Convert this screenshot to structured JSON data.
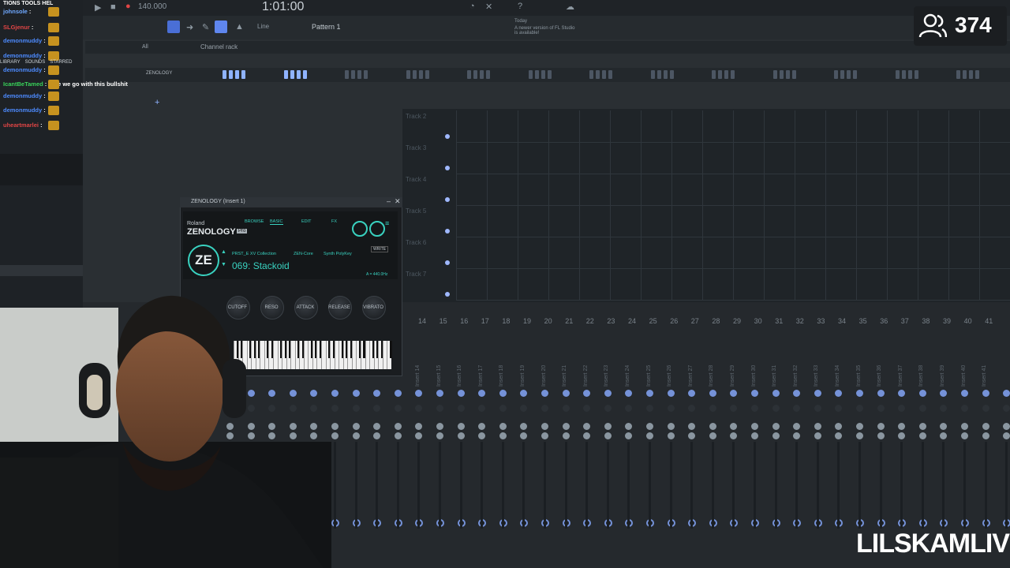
{
  "toolbar": {
    "tempo": "140.000",
    "time": "1:01:00",
    "pattern": "Pattern 1",
    "snap": "Line",
    "news_title": "Today",
    "news_text": "A newer version of FL Studio is available!"
  },
  "browser": {
    "channel_rack_label": "Channel rack",
    "filter_label": "All",
    "channel_name": "ZENOLOGY",
    "tabs": [
      "LIBRARY",
      "SOUNDS",
      "STARRED"
    ]
  },
  "chat": {
    "messages": [
      {
        "user": "johnsole",
        "text": ""
      },
      {
        "user": "SLGjenur",
        "text": ""
      },
      {
        "user": "demonmuddy",
        "text": ""
      },
      {
        "user": "demonmuddy",
        "text": ""
      },
      {
        "user": "demonmuddy",
        "text": ""
      },
      {
        "user": "IcantBeTamed",
        "text": "here we go with this bullshit"
      },
      {
        "user": "demonmuddy",
        "text": ""
      },
      {
        "user": "demonmuddy",
        "text": ""
      },
      {
        "user": "uheartmarlei",
        "text": ""
      }
    ],
    "header": "TIONS TOOLS HEL"
  },
  "playlist": {
    "tracks": [
      "Track 2",
      "Track 3",
      "Track 4",
      "Track 5",
      "Track 6",
      "Track 7"
    ]
  },
  "plugin": {
    "window_title": "ZENOLOGY (Insert 1)",
    "brand": "Roland",
    "product": "ZENOLOGY",
    "edition": "Pro",
    "logo": "ZE",
    "tabs": [
      "BROWSE",
      "BASIC",
      "EDIT",
      "FX"
    ],
    "active_tab": "BASIC",
    "collection": "PRST_E XV Collection",
    "core": "ZEN-Core",
    "category": "Synth PolyKey",
    "patch": "069:  Stackoid",
    "write": "WRITE",
    "tuning": "A = 440.0Hz",
    "knobs": [
      "CUTOFF",
      "RESO",
      "ATTACK",
      "RELEASE",
      "VIBRATO"
    ]
  },
  "mixer": {
    "numbers": [
      "14",
      "15",
      "16",
      "17",
      "18",
      "19",
      "20",
      "21",
      "22",
      "23",
      "24",
      "25",
      "26",
      "27",
      "28",
      "29",
      "30",
      "31",
      "32",
      "33",
      "34",
      "35",
      "36",
      "37",
      "38",
      "39",
      "40",
      "41"
    ],
    "insert_labels": [
      "Insert 14",
      "Insert 15",
      "Insert 16",
      "Insert 17",
      "Insert 18",
      "Insert 19",
      "Insert 20",
      "Insert 21",
      "Insert 22",
      "Insert 23",
      "Insert 24",
      "Insert 25",
      "Insert 26",
      "Insert 27",
      "Insert 28",
      "Insert 29",
      "Insert 30",
      "Insert 31",
      "Insert 32",
      "Insert 33",
      "Insert 34",
      "Insert 35",
      "Insert 36",
      "Insert 37",
      "Insert 38",
      "Insert 39",
      "Insert 40",
      "Insert 41"
    ]
  },
  "stream": {
    "viewer_count": "374",
    "watermark": "LILSKAMLIVE"
  }
}
